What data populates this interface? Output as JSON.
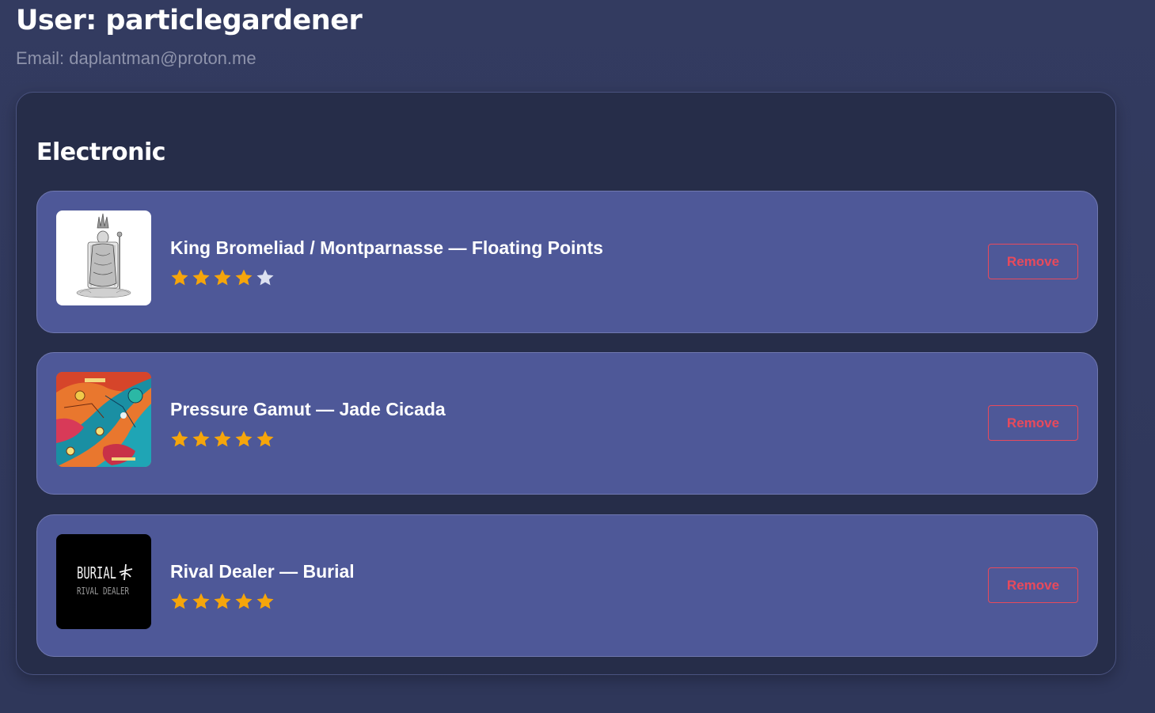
{
  "user": {
    "title": "User: particlegardener",
    "email": "Email: daplantman@proton.me"
  },
  "genre": {
    "title": "Electronic",
    "albums": [
      {
        "title": "King Bromeliad / Montparnasse — Floating Points",
        "rating": 4,
        "max_rating": 5,
        "cover_icon": "king-on-throne-illustration",
        "remove_label": "Remove"
      },
      {
        "title": "Pressure Gamut — Jade Cicada",
        "rating": 5,
        "max_rating": 5,
        "cover_icon": "colorful-map-artwork",
        "remove_label": "Remove"
      },
      {
        "title": "Rival Dealer — Burial",
        "rating": 5,
        "max_rating": 5,
        "cover_icon": "burial-rival-dealer-cover",
        "cover_text_top": "BURIAL",
        "cover_text_bottom": "RIVAL DEALER",
        "remove_label": "Remove"
      }
    ]
  },
  "colors": {
    "star_filled": "#f5a50b",
    "star_empty": "#dde1f0",
    "remove": "#e84a5c",
    "card": "#4e5898",
    "panel": "#262d49"
  }
}
